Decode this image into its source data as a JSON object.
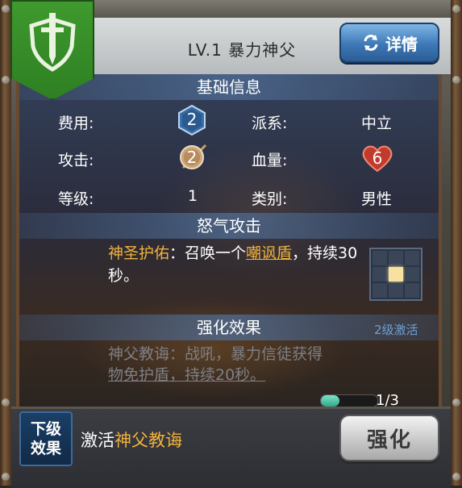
{
  "header": {
    "title": "LV.1 暴力神父",
    "details_label": "详情"
  },
  "basic_info": {
    "heading": "基础信息",
    "cost_label": "费用:",
    "cost_value": "2",
    "faction_label": "派系:",
    "faction_value": "中立",
    "attack_label": "攻击:",
    "attack_value": "2",
    "hp_label": "血量:",
    "hp_value": "6",
    "level_label": "等级:",
    "level_value": "1",
    "category_label": "类别:",
    "category_value": "男性"
  },
  "rage_attack": {
    "heading": "怒气攻击",
    "skill_name": "神圣护佑",
    "desc_part1": "：召唤一个",
    "link_text": "嘲讽盾",
    "desc_part2": "，持续30秒。",
    "grid_active_cell": 4
  },
  "enhance": {
    "heading": "强化效果",
    "activate_level": "2级激活",
    "desc_line1": "神父教诲：战吼，暴力信徒获得",
    "desc_line2": "物免护盾，持续20秒。",
    "progress_text": "1/3",
    "progress_fraction": 0.333
  },
  "footer": {
    "next_label_line1": "下级",
    "next_label_line2": "效果",
    "activate_prefix": "激活",
    "activate_name": "神父教诲",
    "enhance_button": "强化"
  },
  "colors": {
    "accent_gold": "#f2b23c",
    "badge_green": "#3f9a2e",
    "details_blue": "#3d78b6"
  }
}
